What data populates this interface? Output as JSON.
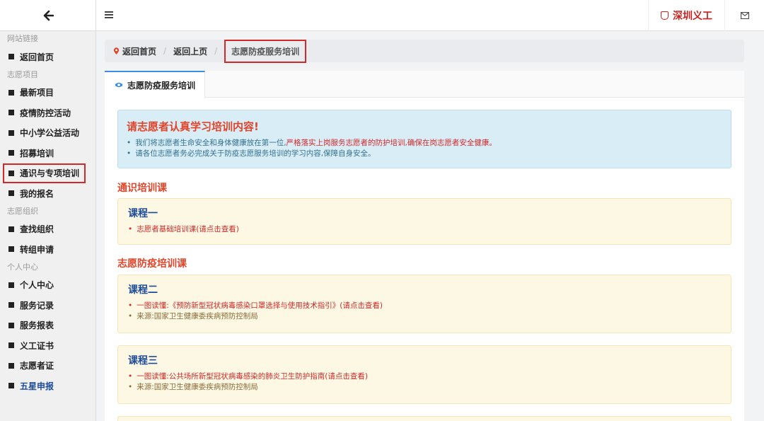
{
  "sidebar": {
    "groups": [
      {
        "title": "网站链接",
        "items": [
          {
            "label": "返回首页"
          }
        ]
      },
      {
        "title": "志愿项目",
        "items": [
          {
            "label": "最新项目"
          },
          {
            "label": "疫情防控活动"
          },
          {
            "label": "中小学公益活动"
          },
          {
            "label": "招募培训"
          },
          {
            "label": "通识与专项培训"
          },
          {
            "label": "我的报名"
          }
        ]
      },
      {
        "title": "志愿组织",
        "items": [
          {
            "label": "查找组织"
          },
          {
            "label": "转组申请"
          }
        ]
      },
      {
        "title": "个人中心",
        "items": [
          {
            "label": "个人中心"
          },
          {
            "label": "服务记录"
          },
          {
            "label": "服务报表"
          },
          {
            "label": "义工证书"
          },
          {
            "label": "志愿者证"
          },
          {
            "label": "五星申报"
          }
        ]
      }
    ]
  },
  "topbar": {
    "brand": "深圳义工"
  },
  "breadcrumb": {
    "home": "返回首页",
    "back": "返回上页",
    "current": "志愿防疫服务培训"
  },
  "tab": {
    "label": "志愿防疫服务培训"
  },
  "notice": {
    "title": "请志愿者认真学习培训内容!",
    "line1_a": "我们将志愿者生命安全和身体健康放在第一位,",
    "line1_b": "严格落实上岗服务志愿者的防护培训,确保在岗志愿者安全健康。",
    "line2": "请各位志愿者务必完成关于防疫志愿服务培训的学习内容,保障自身安全。"
  },
  "sections": {
    "general": "通识培训课",
    "epidemic": "志愿防疫培训课"
  },
  "courses": [
    {
      "title": "课程一",
      "link": "志愿者基础培训课(请点击查看)",
      "source": ""
    },
    {
      "title": "课程二",
      "link": "一图读懂:《预防新型冠状病毒感染口罩选择与使用技术指引》(请点击查看)",
      "source": "来源:国家卫生健康委疾病预防控制局"
    },
    {
      "title": "课程三",
      "link": "一图读懂:公共场所新型冠状病毒感染的肺炎卫生防护指南(请点击查看)",
      "source": "来源:国家卫生健康委疾病预防控制局"
    }
  ],
  "colors": {
    "accent": "#3a8ee6",
    "highlight": "#d12a2a",
    "notice_bg": "#d9edf7",
    "course_bg": "#fcf8e3"
  }
}
